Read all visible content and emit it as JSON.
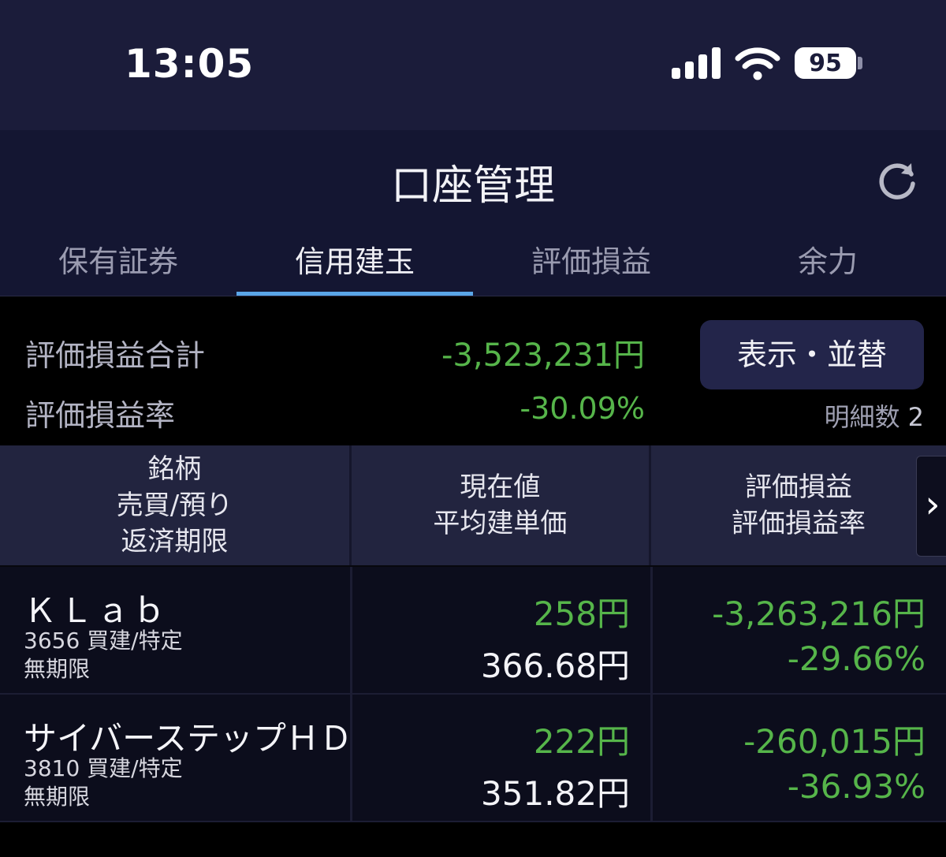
{
  "status_bar": {
    "time": "13:05",
    "battery": "95"
  },
  "header": {
    "title": "口座管理"
  },
  "tabs": [
    {
      "label": "保有証券",
      "active": false
    },
    {
      "label": "信用建玉",
      "active": true
    },
    {
      "label": "評価損益",
      "active": false
    },
    {
      "label": "余力",
      "active": false
    }
  ],
  "summary": {
    "total_label": "評価損益合計",
    "total_value": "-3,523,231円",
    "rate_label": "評価損益率",
    "rate_value": "-30.09%",
    "sort_button": "表示・並替",
    "count_label": "明細数",
    "count_value": "2"
  },
  "table": {
    "headers": {
      "col1": [
        "銘柄",
        "売買/預り",
        "返済期限"
      ],
      "col2": [
        "現在値",
        "平均建単価"
      ],
      "col3": [
        "評価損益",
        "評価損益率"
      ]
    },
    "rows": [
      {
        "name": "ＫＬａｂ",
        "code_trade": "3656 買建/特定",
        "deadline": "無期限",
        "current_price": "258円",
        "avg_price": "366.68円",
        "pnl": "-3,263,216円",
        "pnl_rate": "-29.66%"
      },
      {
        "name": "サイバーステップＨＤ",
        "code_trade": "3810 買建/特定",
        "deadline": "無期限",
        "current_price": "222円",
        "avg_price": "351.82円",
        "pnl": "-260,015円",
        "pnl_rate": "-36.93%"
      }
    ]
  },
  "colors": {
    "status_bar_bg": "#1b1c3a",
    "header_bg": "#141632",
    "tab_indicator": "#5aa6e8",
    "loss_green": "#56b54a",
    "button_bg": "#23254a"
  },
  "icons": {
    "signal": "cellular-signal-icon",
    "wifi": "wifi-icon",
    "battery": "battery-icon",
    "refresh": "refresh-icon",
    "scroll": "chevron-right-icon"
  }
}
